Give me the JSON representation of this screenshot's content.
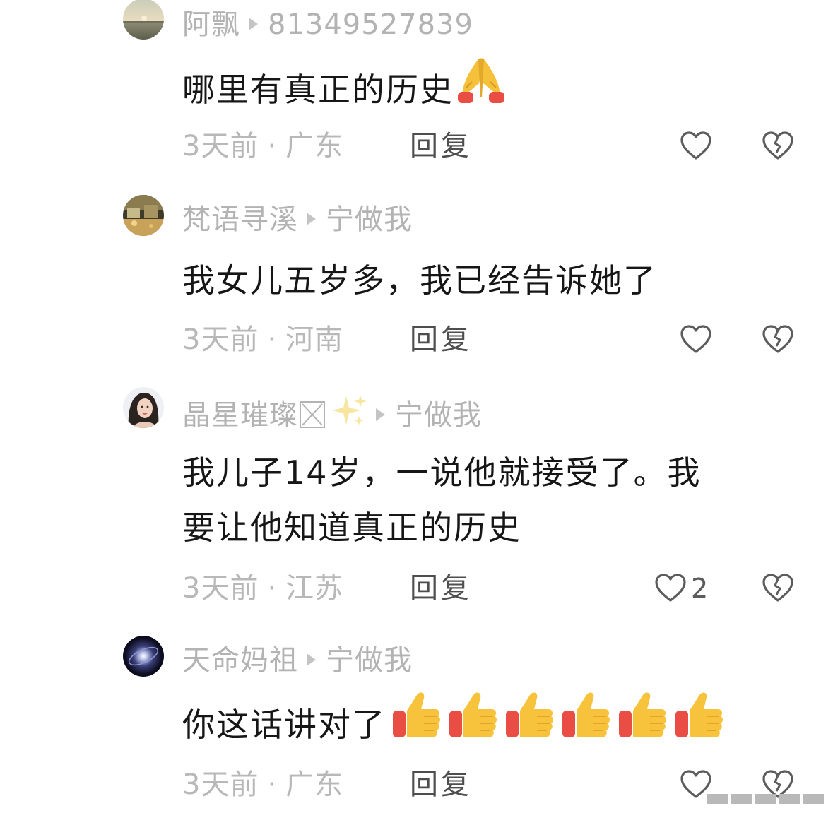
{
  "comments": [
    {
      "username": "阿飘",
      "reply_to": "81349527839",
      "text": "哪里有真正的历史",
      "time": "3天前",
      "location": "广东",
      "reply_label": "回复",
      "like_count": "",
      "avatar": "sunset-lake-avatar",
      "emoji": "folded-hands"
    },
    {
      "username": "梵语寻溪",
      "reply_to": "宁做我",
      "text": "我女儿五岁多，我已经告诉她了",
      "time": "3天前",
      "location": "河南",
      "reply_label": "回复",
      "like_count": "",
      "avatar": "seaside-town-avatar"
    },
    {
      "username": "晶星璀璨",
      "reply_to": "宁做我",
      "text_line1": "我儿子14岁，一说他就接受了。我",
      "text_line2": "要让他知道真正的历史",
      "time": "3天前",
      "location": "江苏",
      "reply_label": "回复",
      "like_count": "2",
      "avatar": "woman-portrait-avatar",
      "emoji": "sparkles"
    },
    {
      "username": "天命妈祖",
      "reply_to": "宁做我",
      "text": "你这话讲对了",
      "time": "3天前",
      "location": "广东",
      "reply_label": "回复",
      "like_count": "",
      "avatar": "galaxy-avatar",
      "emoji": "thumbs-up x6"
    }
  ],
  "colors": {
    "username": "#b3b3b3",
    "body_text": "#161616",
    "meta_text": "#b8b8b8",
    "reply_text": "#4e4e4e",
    "icon_stroke": "#5c5c5c"
  }
}
